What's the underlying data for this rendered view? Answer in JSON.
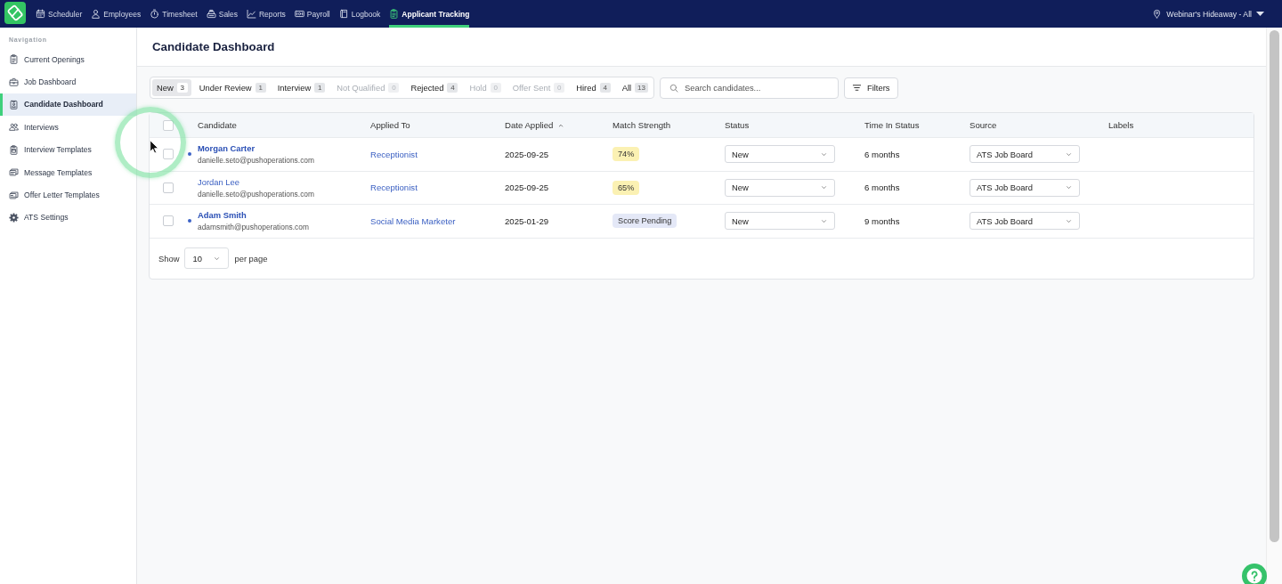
{
  "top_nav": {
    "items": [
      {
        "label": "Scheduler",
        "selected": false
      },
      {
        "label": "Employees",
        "selected": false
      },
      {
        "label": "Timesheet",
        "selected": false
      },
      {
        "label": "Sales",
        "selected": false
      },
      {
        "label": "Reports",
        "selected": false
      },
      {
        "label": "Payroll",
        "selected": false
      },
      {
        "label": "Logbook",
        "selected": false
      },
      {
        "label": "Applicant Tracking",
        "selected": true
      }
    ],
    "location": "Webinar's Hideaway - All"
  },
  "sidebar": {
    "heading": "Navigation",
    "items": [
      {
        "label": "Current Openings",
        "selected": false
      },
      {
        "label": "Job Dashboard",
        "selected": false
      },
      {
        "label": "Candidate Dashboard",
        "selected": true
      },
      {
        "label": "Interviews",
        "selected": false
      },
      {
        "label": "Interview Templates",
        "selected": false
      },
      {
        "label": "Message Templates",
        "selected": false
      },
      {
        "label": "Offer Letter Templates",
        "selected": false
      },
      {
        "label": "ATS Settings",
        "selected": false
      }
    ]
  },
  "page": {
    "title": "Candidate Dashboard"
  },
  "status_tabs": [
    {
      "label": "New",
      "count": "3",
      "selected": true,
      "disabled": false
    },
    {
      "label": "Under Review",
      "count": "1",
      "selected": false,
      "disabled": false
    },
    {
      "label": "Interview",
      "count": "1",
      "selected": false,
      "disabled": false
    },
    {
      "label": "Not Qualified",
      "count": "0",
      "selected": false,
      "disabled": true
    },
    {
      "label": "Rejected",
      "count": "4",
      "selected": false,
      "disabled": false
    },
    {
      "label": "Hold",
      "count": "0",
      "selected": false,
      "disabled": true
    },
    {
      "label": "Offer Sent",
      "count": "0",
      "selected": false,
      "disabled": true
    },
    {
      "label": "Hired",
      "count": "4",
      "selected": false,
      "disabled": false
    },
    {
      "label": "All",
      "count": "13",
      "selected": false,
      "disabled": false
    }
  ],
  "search": {
    "placeholder": "Search candidates..."
  },
  "filters_button": {
    "label": "Filters"
  },
  "table": {
    "select_all_checked": false,
    "columns": [
      {
        "label": "Candidate",
        "sorted": false
      },
      {
        "label": "Applied To",
        "sorted": false
      },
      {
        "label": "Date Applied",
        "sorted": true
      },
      {
        "label": "Match Strength",
        "sorted": false
      },
      {
        "label": "Status",
        "sorted": false
      },
      {
        "label": "Time In Status",
        "sorted": false
      },
      {
        "label": "Source",
        "sorted": false
      },
      {
        "label": "Labels",
        "sorted": false
      }
    ],
    "rows": [
      {
        "checked": false,
        "unread": true,
        "name": "Morgan Carter",
        "email": "danielle.seto@pushoperations.com",
        "applied_to": "Receptionist",
        "date_applied": "2025-09-25",
        "match": {
          "kind": "score",
          "text": "74%"
        },
        "status": "New",
        "time_in_status": "6 months",
        "source": "ATS Job Board"
      },
      {
        "checked": false,
        "unread": false,
        "name": "Jordan Lee",
        "email": "danielle.seto@pushoperations.com",
        "applied_to": "Receptionist",
        "date_applied": "2025-09-25",
        "match": {
          "kind": "score",
          "text": "65%"
        },
        "status": "New",
        "time_in_status": "6 months",
        "source": "ATS Job Board"
      },
      {
        "checked": false,
        "unread": true,
        "name": "Adam Smith",
        "email": "adamsmith@pushoperations.com",
        "applied_to": "Social Media Marketer",
        "date_applied": "2025-01-29",
        "match": {
          "kind": "pending",
          "text": "Score Pending"
        },
        "status": "New",
        "time_in_status": "9 months",
        "source": "ATS Job Board"
      }
    ]
  },
  "pagination": {
    "show_label": "Show",
    "page_size": "10",
    "per_page_label": "per page"
  }
}
